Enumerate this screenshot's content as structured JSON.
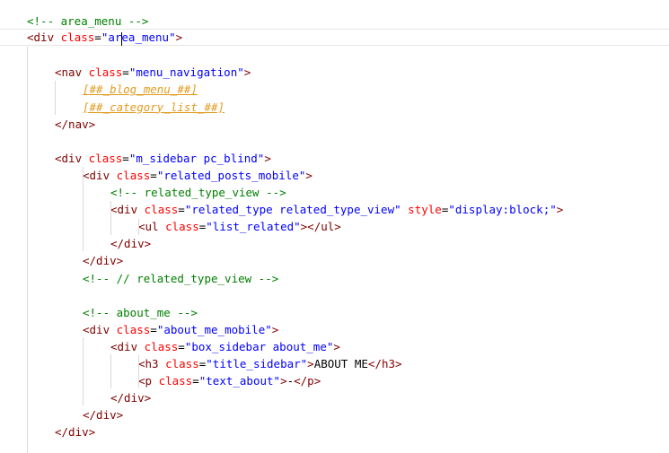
{
  "editor": {
    "lines": [
      {
        "indent": 0,
        "tokens": [
          {
            "t": "cm",
            "v": "<!-- area_menu -->"
          }
        ]
      },
      {
        "indent": 0,
        "current": true,
        "tokens": [
          {
            "t": "tg",
            "v": "<div "
          },
          {
            "t": "at",
            "v": "class"
          },
          {
            "t": "tx",
            "v": "="
          },
          {
            "t": "st",
            "v": "\"area_menu\""
          },
          {
            "t": "tg",
            "v": ">"
          }
        ]
      },
      {
        "indent": 0,
        "tokens": []
      },
      {
        "indent": 1,
        "tokens": [
          {
            "t": "tg",
            "v": "<nav "
          },
          {
            "t": "at",
            "v": "class"
          },
          {
            "t": "tx",
            "v": "="
          },
          {
            "t": "st",
            "v": "\"menu_navigation\""
          },
          {
            "t": "tg",
            "v": ">"
          }
        ]
      },
      {
        "indent": 2,
        "tokens": [
          {
            "t": "ph",
            "v": "[##_blog_menu_##]"
          }
        ]
      },
      {
        "indent": 2,
        "tokens": [
          {
            "t": "ph",
            "v": "[##_category_list_##]"
          }
        ]
      },
      {
        "indent": 1,
        "tokens": [
          {
            "t": "tg",
            "v": "</nav>"
          }
        ]
      },
      {
        "indent": 0,
        "tokens": []
      },
      {
        "indent": 1,
        "tokens": [
          {
            "t": "tg",
            "v": "<div "
          },
          {
            "t": "at",
            "v": "class"
          },
          {
            "t": "tx",
            "v": "="
          },
          {
            "t": "st",
            "v": "\"m_sidebar pc_blind\""
          },
          {
            "t": "tg",
            "v": ">"
          }
        ]
      },
      {
        "indent": 2,
        "tokens": [
          {
            "t": "tg",
            "v": "<div "
          },
          {
            "t": "at",
            "v": "class"
          },
          {
            "t": "tx",
            "v": "="
          },
          {
            "t": "st",
            "v": "\"related_posts_mobile\""
          },
          {
            "t": "tg",
            "v": ">"
          }
        ]
      },
      {
        "indent": 3,
        "tokens": [
          {
            "t": "cm",
            "v": "<!-- related_type_view -->"
          }
        ]
      },
      {
        "indent": 3,
        "tokens": [
          {
            "t": "tg",
            "v": "<div "
          },
          {
            "t": "at",
            "v": "class"
          },
          {
            "t": "tx",
            "v": "="
          },
          {
            "t": "st",
            "v": "\"related_type related_type_view\""
          },
          {
            "t": "tx",
            "v": " "
          },
          {
            "t": "at",
            "v": "style"
          },
          {
            "t": "tx",
            "v": "="
          },
          {
            "t": "st",
            "v": "\"display:block;\""
          },
          {
            "t": "tg",
            "v": ">"
          }
        ]
      },
      {
        "indent": 4,
        "tokens": [
          {
            "t": "tg",
            "v": "<ul "
          },
          {
            "t": "at",
            "v": "class"
          },
          {
            "t": "tx",
            "v": "="
          },
          {
            "t": "st",
            "v": "\"list_related\""
          },
          {
            "t": "tg",
            "v": "></ul>"
          }
        ]
      },
      {
        "indent": 3,
        "tokens": [
          {
            "t": "tg",
            "v": "</div>"
          }
        ]
      },
      {
        "indent": 2,
        "tokens": [
          {
            "t": "tg",
            "v": "</div>"
          }
        ]
      },
      {
        "indent": 2,
        "tokens": [
          {
            "t": "cm",
            "v": "<!-- // related_type_view -->"
          }
        ]
      },
      {
        "indent": 0,
        "tokens": []
      },
      {
        "indent": 2,
        "tokens": [
          {
            "t": "cm",
            "v": "<!-- about_me -->"
          }
        ]
      },
      {
        "indent": 2,
        "tokens": [
          {
            "t": "tg",
            "v": "<div "
          },
          {
            "t": "at",
            "v": "class"
          },
          {
            "t": "tx",
            "v": "="
          },
          {
            "t": "st",
            "v": "\"about_me_mobile\""
          },
          {
            "t": "tg",
            "v": ">"
          }
        ]
      },
      {
        "indent": 3,
        "tokens": [
          {
            "t": "tg",
            "v": "<div "
          },
          {
            "t": "at",
            "v": "class"
          },
          {
            "t": "tx",
            "v": "="
          },
          {
            "t": "st",
            "v": "\"box_sidebar about_me\""
          },
          {
            "t": "tg",
            "v": ">"
          }
        ]
      },
      {
        "indent": 4,
        "tokens": [
          {
            "t": "tg",
            "v": "<h3 "
          },
          {
            "t": "at",
            "v": "class"
          },
          {
            "t": "tx",
            "v": "="
          },
          {
            "t": "st",
            "v": "\"title_sidebar\""
          },
          {
            "t": "tg",
            "v": ">"
          },
          {
            "t": "tx",
            "v": "ABOUT ME"
          },
          {
            "t": "tg",
            "v": "</h3>"
          }
        ]
      },
      {
        "indent": 4,
        "tokens": [
          {
            "t": "tg",
            "v": "<p "
          },
          {
            "t": "at",
            "v": "class"
          },
          {
            "t": "tx",
            "v": "="
          },
          {
            "t": "st",
            "v": "\"text_about\""
          },
          {
            "t": "tg",
            "v": ">"
          },
          {
            "t": "tx",
            "v": "-"
          },
          {
            "t": "tg",
            "v": "</p>"
          }
        ]
      },
      {
        "indent": 3,
        "tokens": [
          {
            "t": "tg",
            "v": "</div>"
          }
        ]
      },
      {
        "indent": 2,
        "tokens": [
          {
            "t": "tg",
            "v": "</div>"
          }
        ]
      },
      {
        "indent": 1,
        "tokens": [
          {
            "t": "tg",
            "v": "</div>"
          }
        ]
      }
    ]
  },
  "colors": {
    "comment": "#008000",
    "tag": "#800000",
    "attribute": "#ff0000",
    "string": "#0000ff",
    "text": "#000000",
    "placeholder": "#e29b1f"
  }
}
